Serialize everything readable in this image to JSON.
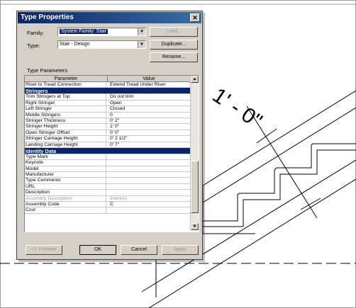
{
  "dialog": {
    "title": "Type Properties",
    "family_label": "Family:",
    "family_value": "System Family: Stair",
    "type_label": "Type:",
    "type_value": "Stair - Design",
    "load_button": "Load...",
    "duplicate_button": "Duplicate...",
    "rename_button": "Rename...",
    "type_parameters_label": "Type Parameters",
    "col_parameter": "Parameter",
    "col_value": "Value",
    "rows": [
      {
        "kind": "row",
        "p": "Riser to Tread Connection",
        "v": "Extend Tread Under Riser"
      },
      {
        "kind": "group",
        "p": "Stringers",
        "v": ""
      },
      {
        "kind": "row",
        "p": "Trim Stringers at Top",
        "v": "Do not trim"
      },
      {
        "kind": "row",
        "p": "Right Stringer",
        "v": "Open"
      },
      {
        "kind": "row",
        "p": "Left Stringer",
        "v": "Closed"
      },
      {
        "kind": "row",
        "p": "Middle Stringers",
        "v": "0"
      },
      {
        "kind": "row",
        "p": "Stringer Thickness",
        "v": "0'  2\""
      },
      {
        "kind": "row",
        "p": "Stringer Height",
        "v": "1'  0\""
      },
      {
        "kind": "row",
        "p": "Open Stringer Offset",
        "v": "0'  0\""
      },
      {
        "kind": "row",
        "p": "Stringer Carriage Height",
        "v": "0'  2 1/2\""
      },
      {
        "kind": "row",
        "p": "Landing Carriage Height",
        "v": "0'  7\""
      },
      {
        "kind": "group",
        "p": "Identity Data",
        "v": ""
      },
      {
        "kind": "row",
        "p": "Type Mark",
        "v": ""
      },
      {
        "kind": "row",
        "p": "Keynote",
        "v": ""
      },
      {
        "kind": "row",
        "p": "Model",
        "v": ""
      },
      {
        "kind": "row",
        "p": "Manufacturer",
        "v": ""
      },
      {
        "kind": "row",
        "p": "Type Comments",
        "v": ""
      },
      {
        "kind": "row",
        "p": "URL",
        "v": ""
      },
      {
        "kind": "row",
        "p": "Description",
        "v": ""
      },
      {
        "kind": "dim",
        "p": "Assembly Description",
        "v": "Interiors"
      },
      {
        "kind": "row",
        "p": "Assembly Code",
        "v": "C"
      },
      {
        "kind": "row",
        "p": "Cost",
        "v": ""
      }
    ],
    "preview_button": "<< Preview",
    "ok_button": "OK",
    "cancel_button": "Cancel",
    "apply_button": "Apply"
  },
  "drawing": {
    "dimension_text": "1' - 0\""
  }
}
